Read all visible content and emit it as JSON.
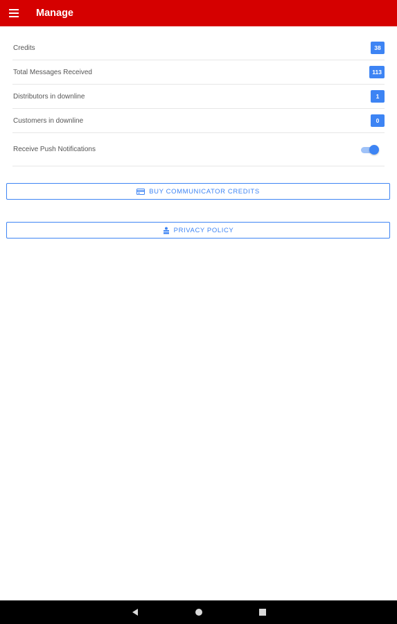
{
  "header": {
    "title": "Manage",
    "background": "#d50000",
    "menu_icon": "menu-icon"
  },
  "stats": [
    {
      "label": "Credits",
      "value": "38"
    },
    {
      "label": "Total Messages Received",
      "value": "113"
    },
    {
      "label": "Distributors in downline",
      "value": "1"
    },
    {
      "label": "Customers in downline",
      "value": "0"
    }
  ],
  "push": {
    "label": "Receive Push Notifications",
    "enabled": true
  },
  "buttons": {
    "buy_credits": {
      "label": "BUY COMMUNICATOR CREDITS",
      "icon": "credit-card-icon"
    },
    "privacy_policy": {
      "label": "PRIVACY POLICY",
      "icon": "privacy-icon"
    }
  },
  "accent": "#3d84f4",
  "navbar": {
    "icons": [
      "back-icon",
      "home-icon",
      "recents-icon"
    ]
  }
}
